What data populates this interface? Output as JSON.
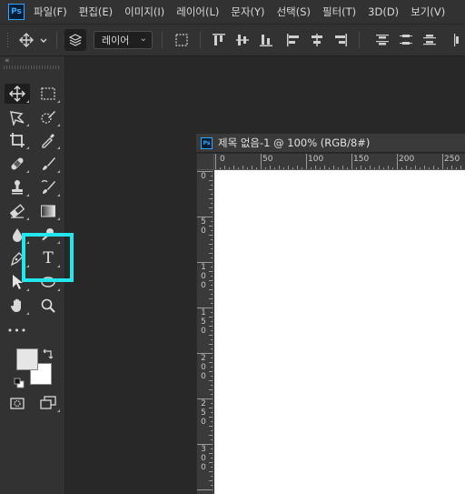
{
  "app": {
    "logo_text": "Ps"
  },
  "menu": [
    "파일(F)",
    "편집(E)",
    "이미지(I)",
    "레이어(L)",
    "문자(Y)",
    "선택(S)",
    "필터(T)",
    "3D(D)",
    "보기(V)"
  ],
  "options_bar": {
    "auto_select_target": "레이어"
  },
  "toolbar": {
    "collapse_label": "«",
    "edit_toolbar_label": "•••",
    "selected_tool": "move-tool",
    "highlighted_tool": "type-tool",
    "type_tool_glyph": "T"
  },
  "colors": {
    "foreground": "#e6e6e6",
    "background": "#ffffff",
    "highlight": "#23e7ee",
    "accent": "#31a8ff"
  },
  "document": {
    "title": "제목 없음-1 @ 100% (RGB/8#)",
    "ruler_top": [
      "0",
      "50",
      "100",
      "150",
      "200",
      "250"
    ],
    "ruler_left": [
      "0",
      "50",
      "100",
      "150",
      "200",
      "250",
      "300"
    ]
  }
}
